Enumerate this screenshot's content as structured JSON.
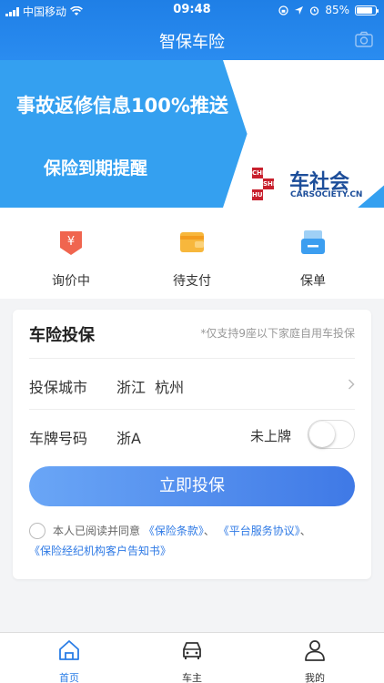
{
  "status_bar": {
    "carrier": "中国移动",
    "time": "09:48",
    "battery": "85%"
  },
  "header": {
    "title": "智保车险"
  },
  "banner": {
    "line1": "事故返修信息100%推送",
    "line2": "保险到期提醒",
    "logo_cells": [
      "CHE",
      "SHE",
      "HUI"
    ],
    "logo_cn": "车社会",
    "logo_en": "CARSOCIETY.CN",
    "page_count": 2,
    "active_page": 1
  },
  "quick_actions": [
    {
      "label": "询价中",
      "icon": "yen-badge-icon"
    },
    {
      "label": "待支付",
      "icon": "wallet-icon"
    },
    {
      "label": "保单",
      "icon": "policy-tray-icon"
    }
  ],
  "form": {
    "title": "车险投保",
    "note": "*仅支持9座以下家庭自用车投保",
    "city_label": "投保城市",
    "city_value": "浙江  杭州",
    "plate_label": "车牌号码",
    "plate_value": "浙A",
    "unplated_label": "未上牌",
    "unplated_on": false,
    "submit_label": "立即投保",
    "agree_text": "本人已阅读并同意",
    "link1": "《保险条款》",
    "sep": "、",
    "link2": "《平台服务协议》",
    "sep2": "、",
    "link3": "《保险经纪机构客户告知书》"
  },
  "tabs": [
    {
      "label": "首页",
      "active": true
    },
    {
      "label": "车主",
      "active": false
    },
    {
      "label": "我的",
      "active": false
    }
  ],
  "colors": {
    "brand": "#2a7de6",
    "banner": "#34a0f0",
    "logo_red": "#c8202d",
    "logo_blue": "#1d4e9a"
  }
}
